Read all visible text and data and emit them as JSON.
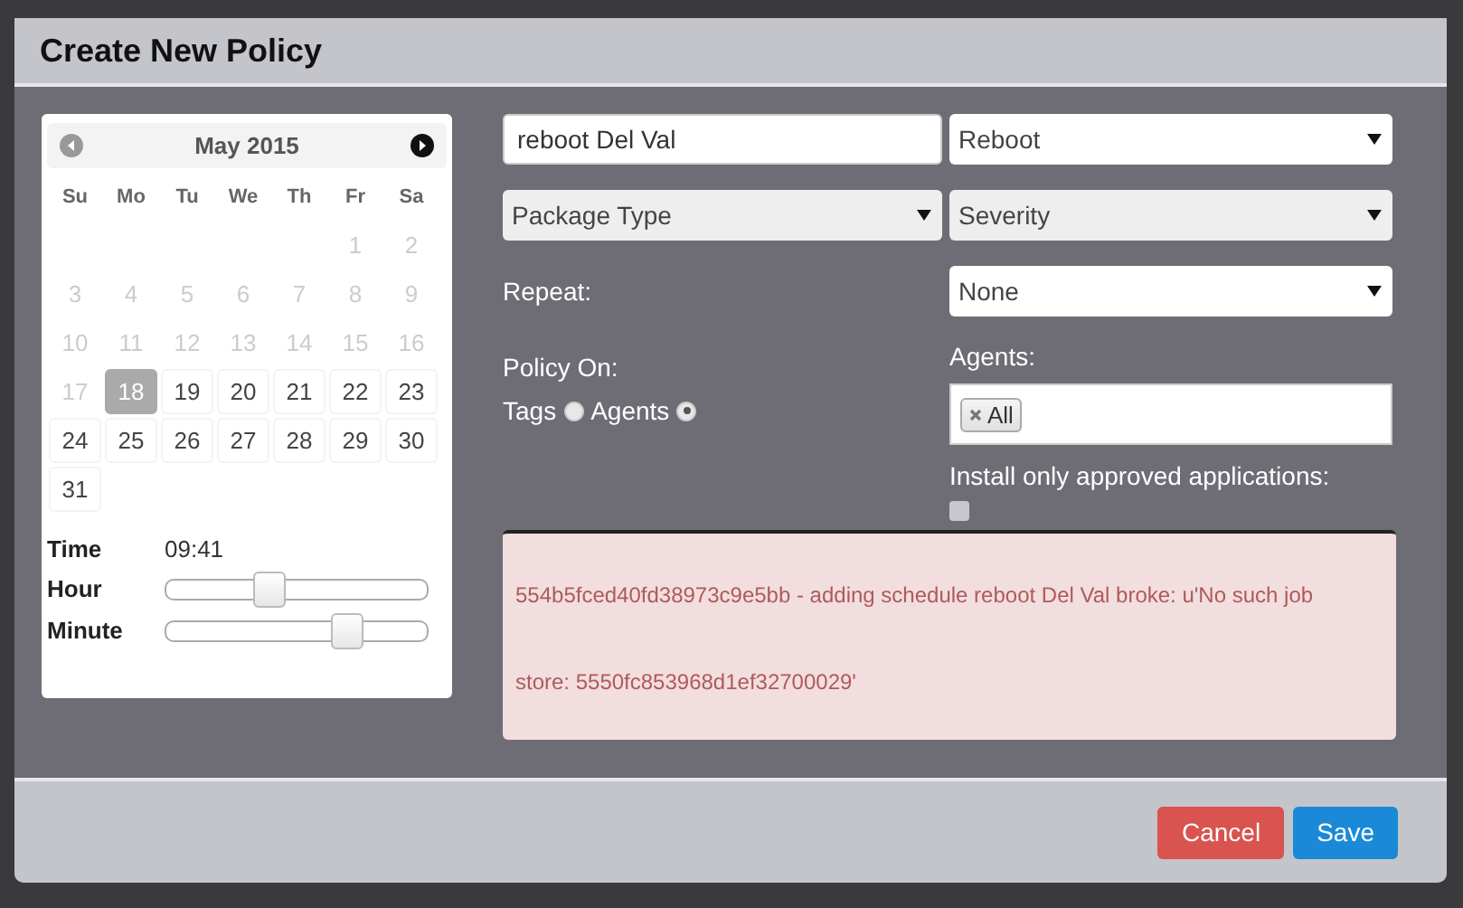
{
  "dialog": {
    "title": "Create New Policy"
  },
  "calendar": {
    "month": "May 2015",
    "nav": [
      {
        "kind": "prev",
        "disabled": true
      },
      {
        "kind": "next",
        "disabled": false
      }
    ],
    "weekdays": [
      "Su",
      "Mo",
      "Tu",
      "We",
      "Th",
      "Fr",
      "Sa"
    ],
    "weeks": [
      {
        "kind": "leading",
        "days": [
          {
            "day": "1",
            "disabled": true,
            "selected": false
          },
          {
            "day": "2",
            "disabled": true,
            "selected": false
          }
        ]
      },
      {
        "kind": "full",
        "days": [
          {
            "day": "3",
            "disabled": true,
            "selected": false
          },
          {
            "day": "4",
            "disabled": true,
            "selected": false
          },
          {
            "day": "5",
            "disabled": true,
            "selected": false
          },
          {
            "day": "6",
            "disabled": true,
            "selected": false
          },
          {
            "day": "7",
            "disabled": true,
            "selected": false
          },
          {
            "day": "8",
            "disabled": true,
            "selected": false
          },
          {
            "day": "9",
            "disabled": true,
            "selected": false
          }
        ]
      },
      {
        "kind": "full",
        "days": [
          {
            "day": "10",
            "disabled": true,
            "selected": false
          },
          {
            "day": "11",
            "disabled": true,
            "selected": false
          },
          {
            "day": "12",
            "disabled": true,
            "selected": false
          },
          {
            "day": "13",
            "disabled": true,
            "selected": false
          },
          {
            "day": "14",
            "disabled": true,
            "selected": false
          },
          {
            "day": "15",
            "disabled": true,
            "selected": false
          },
          {
            "day": "16",
            "disabled": true,
            "selected": false
          }
        ]
      },
      {
        "kind": "full",
        "days": [
          {
            "day": "17",
            "disabled": true,
            "selected": false
          },
          {
            "day": "18",
            "disabled": false,
            "selected": true
          },
          {
            "day": "19",
            "disabled": false,
            "selected": false
          },
          {
            "day": "20",
            "disabled": false,
            "selected": false
          },
          {
            "day": "21",
            "disabled": false,
            "selected": false
          },
          {
            "day": "22",
            "disabled": false,
            "selected": false
          },
          {
            "day": "23",
            "disabled": false,
            "selected": false
          }
        ]
      },
      {
        "kind": "full",
        "days": [
          {
            "day": "24",
            "disabled": false,
            "selected": false
          },
          {
            "day": "25",
            "disabled": false,
            "selected": false
          },
          {
            "day": "26",
            "disabled": false,
            "selected": false
          },
          {
            "day": "27",
            "disabled": false,
            "selected": false
          },
          {
            "day": "28",
            "disabled": false,
            "selected": false
          },
          {
            "day": "29",
            "disabled": false,
            "selected": false
          },
          {
            "day": "30",
            "disabled": false,
            "selected": false
          }
        ]
      },
      {
        "kind": "trailing",
        "days": [
          {
            "day": "31",
            "disabled": false,
            "selected": false
          }
        ]
      }
    ],
    "time": {
      "label": "Time",
      "value": "09:41"
    },
    "sliders": [
      {
        "label": "Hour",
        "level": 0.39
      },
      {
        "label": "Minute",
        "level": 0.69
      }
    ]
  },
  "form": {
    "name_field": {
      "value": "reboot Del Val"
    },
    "operation_select": {
      "value": "Reboot",
      "disabled": false
    },
    "package_type_select": {
      "value": "Package Type",
      "disabled": true
    },
    "severity_select": {
      "value": "Severity",
      "disabled": true
    },
    "repeat_label": "Repeat:",
    "repeat_select": {
      "value": "None",
      "disabled": false
    },
    "policy_on_label": "Policy On:",
    "policy_on_options": [
      {
        "label": "Tags",
        "selected": false
      },
      {
        "label": "Agents",
        "selected": true
      }
    ],
    "agents_label": "Agents:",
    "agents_tags": [
      "All"
    ],
    "approved_label": "Install only approved applications:",
    "approved_checked": false
  },
  "error": {
    "lines": [
      "554b5fced40fd38973c9e5bb - adding schedule reboot Del Val broke: u'No such job",
      "store: 5550fc853968d1ef32700029'"
    ]
  },
  "buttons": [
    {
      "label": "Cancel",
      "kind": "danger"
    },
    {
      "label": "Save",
      "kind": "primary"
    }
  ]
}
